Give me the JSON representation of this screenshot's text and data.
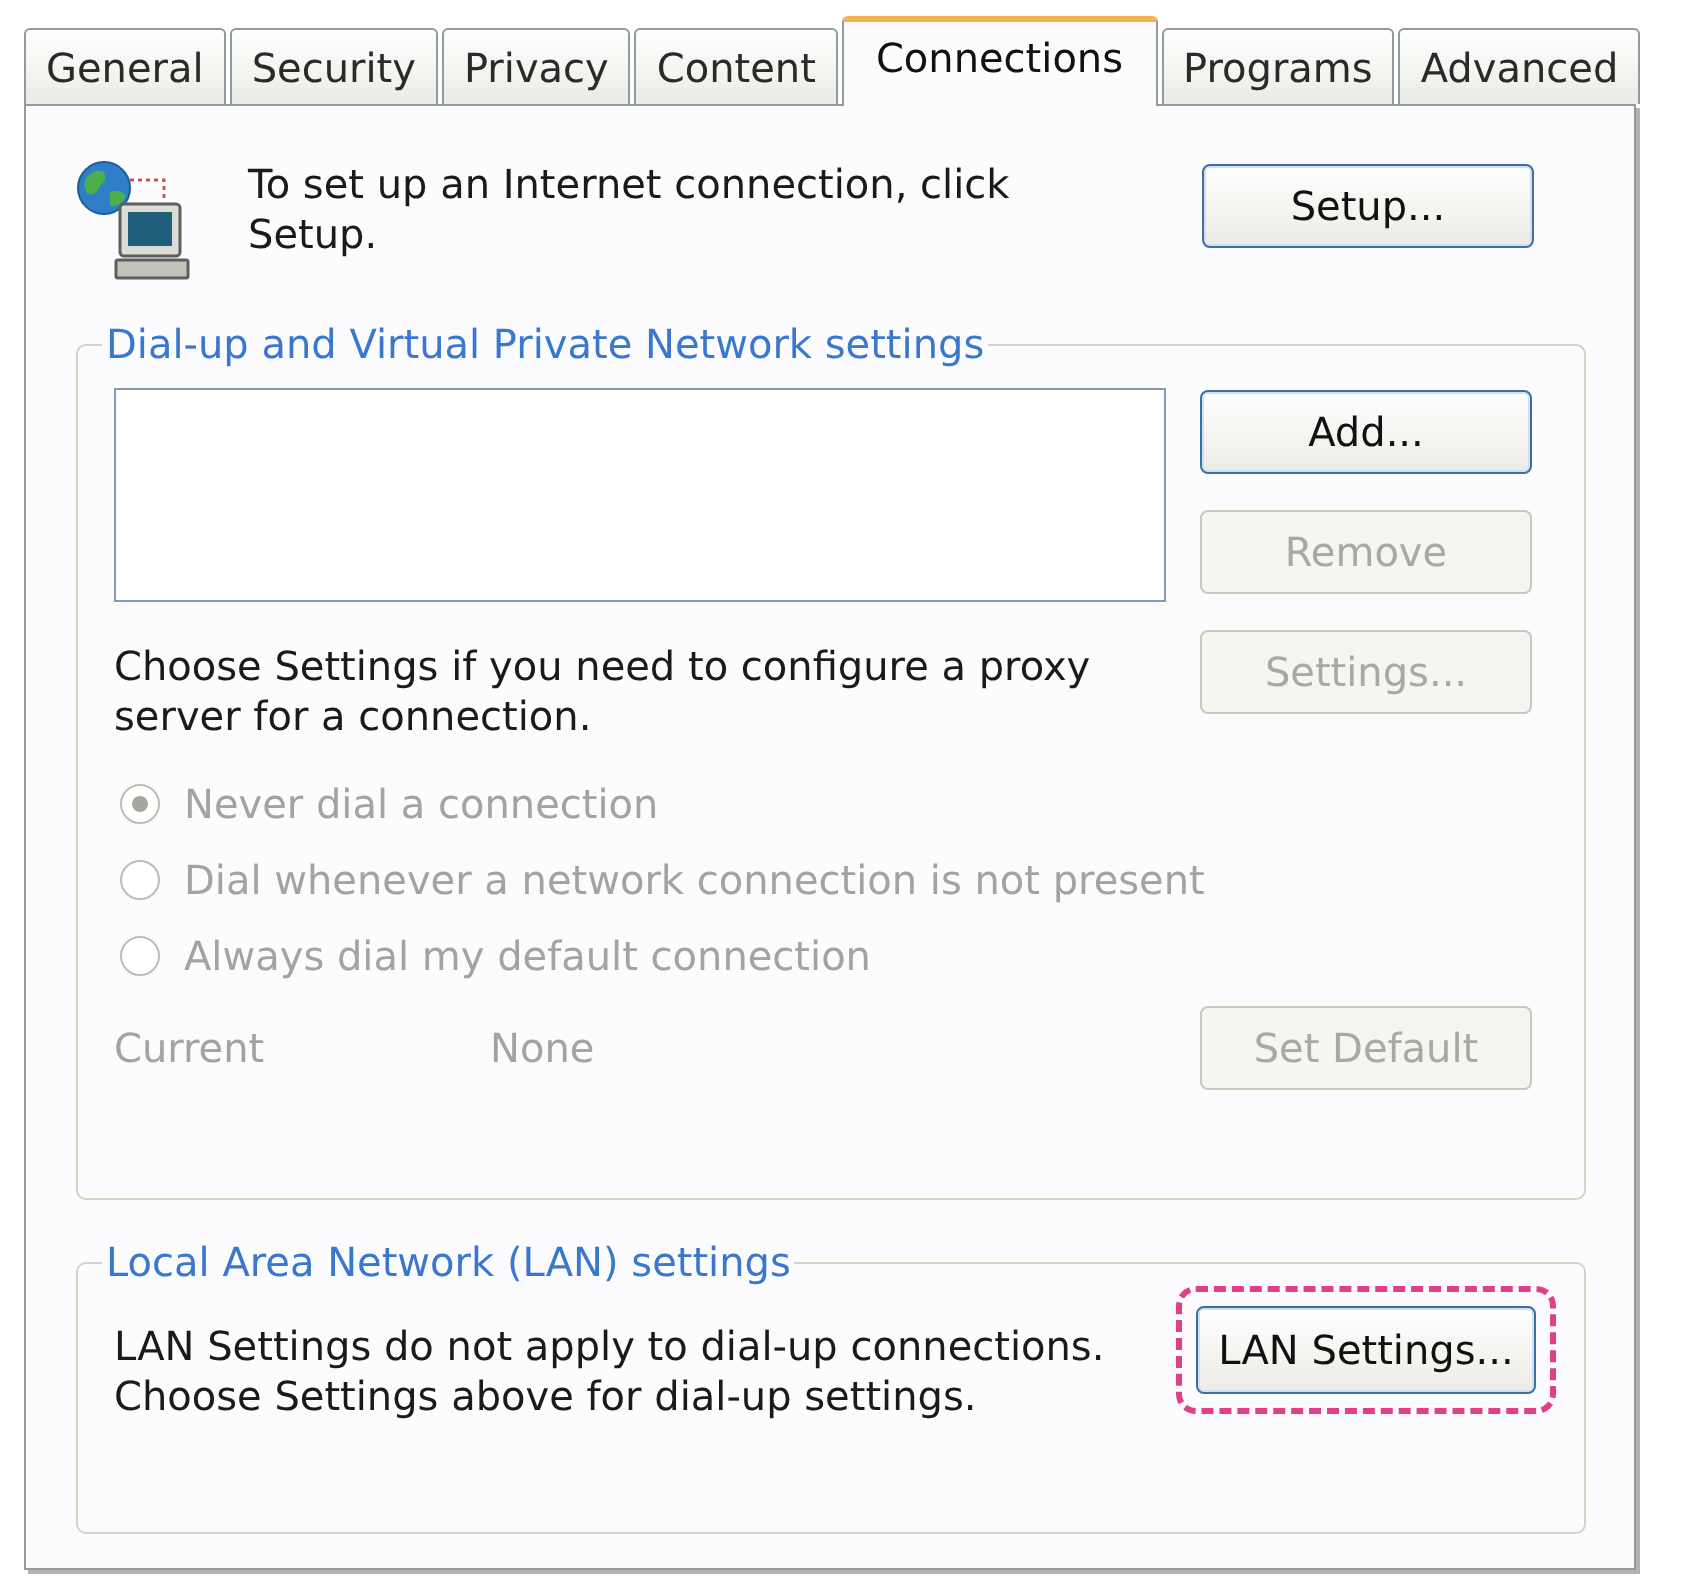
{
  "tabs": [
    {
      "label": "General",
      "selected": false
    },
    {
      "label": "Security",
      "selected": false
    },
    {
      "label": "Privacy",
      "selected": false
    },
    {
      "label": "Content",
      "selected": false
    },
    {
      "label": "Connections",
      "selected": true
    },
    {
      "label": "Programs",
      "selected": false
    },
    {
      "label": "Advanced",
      "selected": false
    }
  ],
  "setup": {
    "text": "To set up an Internet connection, click Setup.",
    "button": {
      "label": "Setup...",
      "disabled": false
    }
  },
  "dialup": {
    "title": "Dial-up and Virtual Private Network settings",
    "buttons": [
      {
        "label": "Add...",
        "disabled": false
      },
      {
        "label": "Remove",
        "disabled": true
      },
      {
        "label": "Settings...",
        "disabled": true
      }
    ],
    "proxy_text": "Choose Settings if you need to configure a proxy server for a connection.",
    "radios": [
      {
        "label": "Never dial a connection",
        "selected": true,
        "disabled": true
      },
      {
        "label": "Dial whenever a network connection is not present",
        "selected": false,
        "disabled": true
      },
      {
        "label": "Always dial my default connection",
        "selected": false,
        "disabled": true
      }
    ],
    "current": {
      "label": "Current",
      "value": "None",
      "disabled": true
    },
    "default_button": {
      "label": "Set Default",
      "disabled": true
    }
  },
  "lan": {
    "title": "Local Area Network (LAN) settings",
    "text": "LAN Settings do not apply to dial-up connections. Choose Settings above for dial-up settings.",
    "button": {
      "label": "LAN Settings...",
      "disabled": false,
      "highlighted": true
    }
  }
}
